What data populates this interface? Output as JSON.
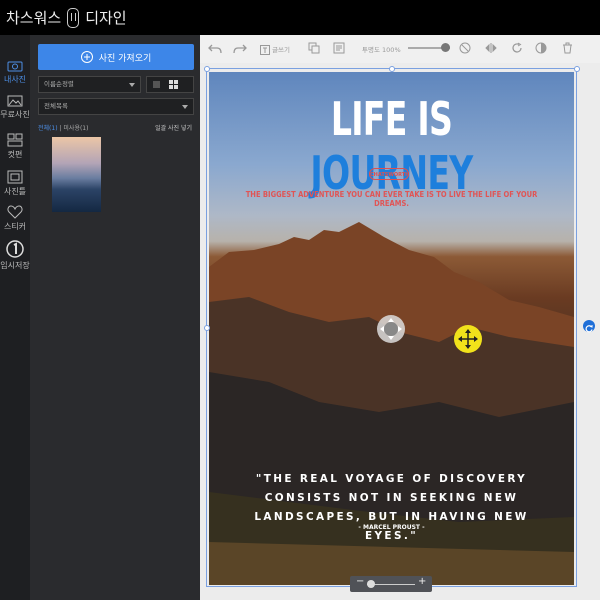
{
  "app": {
    "title": "차스워스",
    "title_suffix": "디자인"
  },
  "iconbar": [
    {
      "name": "photos",
      "label": "내사진",
      "active": true
    },
    {
      "name": "free-photos",
      "label": "무료사진",
      "active": false
    },
    {
      "name": "layout",
      "label": "컷편",
      "active": false
    },
    {
      "name": "photo-frame",
      "label": "사진틀",
      "active": false
    },
    {
      "name": "sticker",
      "label": "스티커",
      "active": false
    },
    {
      "name": "temp-save",
      "label": "임시저장",
      "active": false
    }
  ],
  "panel": {
    "import_button": "사진 가져오기",
    "sort_select": "이름순정렬",
    "folder_select": "전체목록",
    "filter_all": "전체(1)",
    "filter_unused": "미사용(1)",
    "insert_all": "일괄 사진 넣기"
  },
  "toolbar": {
    "text_box_label": "글쓰기",
    "opacity_label": "투명도",
    "opacity_value": "100%",
    "opacity_fraction": 1.0
  },
  "poster": {
    "title_white": "LIFE IS",
    "title_blue": "JOURNEY",
    "badge": "CHATSWORTH",
    "tagline": "THE BIGGEST ADVENTURE YOU CAN EVER TAKE IS TO LIVE THE LIFE OF YOUR DREAMS.",
    "quote": "\"THE REAL VOYAGE OF DISCOVERY CONSISTS NOT IN SEEKING NEW LANDSCAPES, BUT IN HAVING NEW EYES.\"",
    "attribution": "- MARCEL PROUST -"
  },
  "zoom": {
    "minus": "−",
    "plus": "+"
  },
  "colors": {
    "accent": "#3d86e8",
    "title_blue": "#1e7fdc",
    "tag_red": "#e05555",
    "handle_yellow": "#f1e21b"
  }
}
